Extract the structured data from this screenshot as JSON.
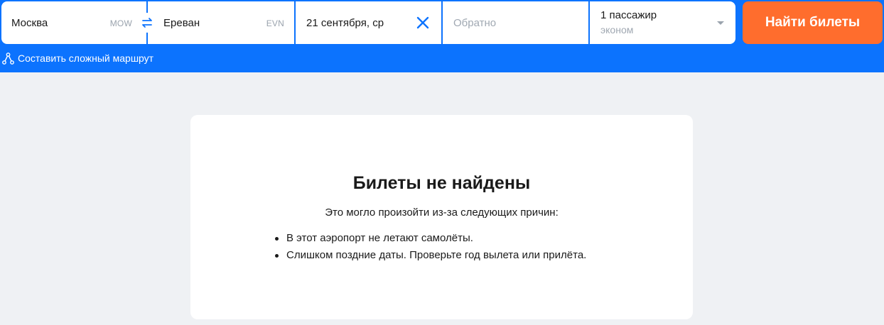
{
  "search": {
    "origin": {
      "city": "Москва",
      "code": "MOW"
    },
    "destination": {
      "city": "Ереван",
      "code": "EVN"
    },
    "depart_date": "21 сентября, ср",
    "return_placeholder": "Обратно",
    "passengers": "1 пассажир",
    "cabin_class": "эконом",
    "search_button": "Найти билеты",
    "complex_route_link": "Составить сложный маршрут"
  },
  "result": {
    "title": "Билеты не найдены",
    "subtitle": "Это могло произойти из-за следующих причин:",
    "reasons": [
      "В этот аэропорт не летают самолёты.",
      "Слишком поздние даты. Проверьте год вылета или прилёта."
    ]
  },
  "colors": {
    "brand_blue": "#0c73fe",
    "cta_orange": "#ff6d2d",
    "page_bg": "#eff1f4"
  },
  "icons": [
    "swap-arrows-icon",
    "clear-x-icon",
    "dropdown-caret-icon",
    "route-nodes-icon"
  ]
}
